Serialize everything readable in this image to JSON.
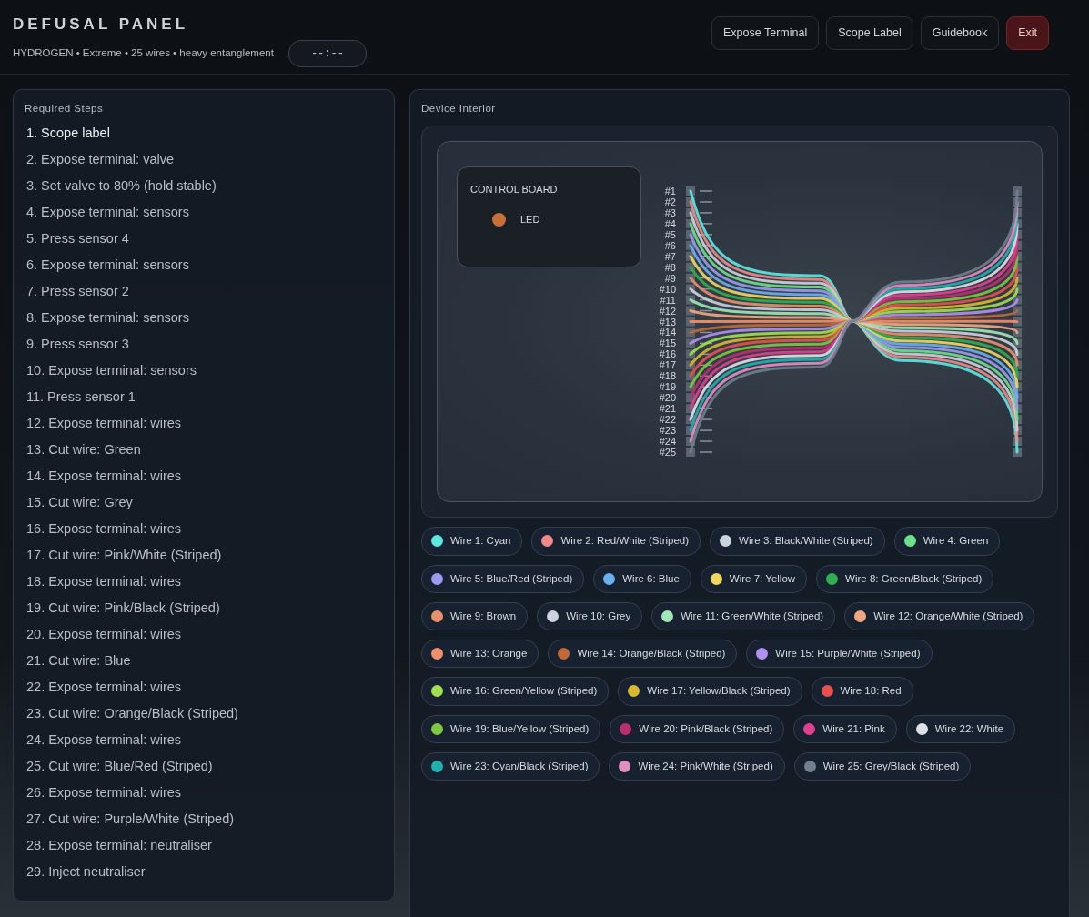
{
  "header": {
    "title": "DEFUSAL PANEL",
    "subtitle": "HYDROGEN • Extreme • 25 wires • heavy entanglement",
    "timer": "--:--",
    "buttons": [
      {
        "label": "Expose Terminal",
        "kind": "normal"
      },
      {
        "label": "Scope Label",
        "kind": "normal"
      },
      {
        "label": "Guidebook",
        "kind": "normal"
      },
      {
        "label": "Exit",
        "kind": "danger"
      }
    ]
  },
  "steps_panel": {
    "title": "Required Steps",
    "steps": [
      {
        "text": "1. Scope label",
        "current": true
      },
      {
        "text": "2. Expose terminal: valve",
        "current": false
      },
      {
        "text": "3. Set valve to 80% (hold stable)",
        "current": false
      },
      {
        "text": "4. Expose terminal: sensors",
        "current": false
      },
      {
        "text": "5. Press sensor 4",
        "current": false
      },
      {
        "text": "6. Expose terminal: sensors",
        "current": false
      },
      {
        "text": "7. Press sensor 2",
        "current": false
      },
      {
        "text": "8. Expose terminal: sensors",
        "current": false
      },
      {
        "text": "9. Press sensor 3",
        "current": false
      },
      {
        "text": "10. Expose terminal: sensors",
        "current": false
      },
      {
        "text": "11. Press sensor 1",
        "current": false
      },
      {
        "text": "12. Expose terminal: wires",
        "current": false
      },
      {
        "text": "13. Cut wire: Green",
        "current": false
      },
      {
        "text": "14. Expose terminal: wires",
        "current": false
      },
      {
        "text": "15. Cut wire: Grey",
        "current": false
      },
      {
        "text": "16. Expose terminal: wires",
        "current": false
      },
      {
        "text": "17. Cut wire: Pink/White (Striped)",
        "current": false
      },
      {
        "text": "18. Expose terminal: wires",
        "current": false
      },
      {
        "text": "19. Cut wire: Pink/Black (Striped)",
        "current": false
      },
      {
        "text": "20. Expose terminal: wires",
        "current": false
      },
      {
        "text": "21. Cut wire: Blue",
        "current": false
      },
      {
        "text": "22. Expose terminal: wires",
        "current": false
      },
      {
        "text": "23. Cut wire: Orange/Black (Striped)",
        "current": false
      },
      {
        "text": "24. Expose terminal: wires",
        "current": false
      },
      {
        "text": "25. Cut wire: Blue/Red (Striped)",
        "current": false
      },
      {
        "text": "26. Expose terminal: wires",
        "current": false
      },
      {
        "text": "27. Cut wire: Purple/White (Striped)",
        "current": false
      },
      {
        "text": "28. Expose terminal: neutraliser",
        "current": false
      },
      {
        "text": "29. Inject neutraliser",
        "current": false
      }
    ]
  },
  "device": {
    "title": "Device Interior",
    "control_board": {
      "title": "CONTROL BOARD",
      "led": {
        "label": "LED",
        "color": "#c87038"
      }
    },
    "pins": [
      "#1",
      "#2",
      "#3",
      "#4",
      "#5",
      "#6",
      "#7",
      "#8",
      "#9",
      "#10",
      "#11",
      "#12",
      "#13",
      "#14",
      "#15",
      "#16",
      "#17",
      "#18",
      "#19",
      "#20",
      "#21",
      "#22",
      "#23",
      "#24",
      "#25"
    ],
    "wires": [
      {
        "label": "Wire 1: Cyan",
        "color": "#5ee8e0"
      },
      {
        "label": "Wire 2: Red/White (Striped)",
        "color": "#f08a8a"
      },
      {
        "label": "Wire 3: Black/White (Striped)",
        "color": "#cdd3dc"
      },
      {
        "label": "Wire 4: Green",
        "color": "#6ee08a"
      },
      {
        "label": "Wire 5: Blue/Red (Striped)",
        "color": "#9b9bf0"
      },
      {
        "label": "Wire 6: Blue",
        "color": "#6ab0f0"
      },
      {
        "label": "Wire 7: Yellow",
        "color": "#f0d860"
      },
      {
        "label": "Wire 8: Green/Black (Striped)",
        "color": "#2fb050"
      },
      {
        "label": "Wire 9: Brown",
        "color": "#e8906a"
      },
      {
        "label": "Wire 10: Grey",
        "color": "#cdd3dc"
      },
      {
        "label": "Wire 11: Green/White (Striped)",
        "color": "#a0e8b8"
      },
      {
        "label": "Wire 12: Orange/White (Striped)",
        "color": "#f0a880"
      },
      {
        "label": "Wire 13: Orange",
        "color": "#f0906a"
      },
      {
        "label": "Wire 14: Orange/Black (Striped)",
        "color": "#c06a3a"
      },
      {
        "label": "Wire 15: Purple/White (Striped)",
        "color": "#b090f0"
      },
      {
        "label": "Wire 16: Green/Yellow (Striped)",
        "color": "#a0e050"
      },
      {
        "label": "Wire 17: Yellow/Black (Striped)",
        "color": "#d8b830"
      },
      {
        "label": "Wire 18: Red",
        "color": "#e85050"
      },
      {
        "label": "Wire 19: Blue/Yellow (Striped)",
        "color": "#80c840"
      },
      {
        "label": "Wire 20: Pink/Black (Striped)",
        "color": "#b83070"
      },
      {
        "label": "Wire 21: Pink",
        "color": "#e04090"
      },
      {
        "label": "Wire 22: White",
        "color": "#e0e0e8"
      },
      {
        "label": "Wire 23: Cyan/Black (Striped)",
        "color": "#20b0b0"
      },
      {
        "label": "Wire 24: Pink/White (Striped)",
        "color": "#e090c0"
      },
      {
        "label": "Wire 25: Grey/Black (Striped)",
        "color": "#708090"
      }
    ]
  }
}
